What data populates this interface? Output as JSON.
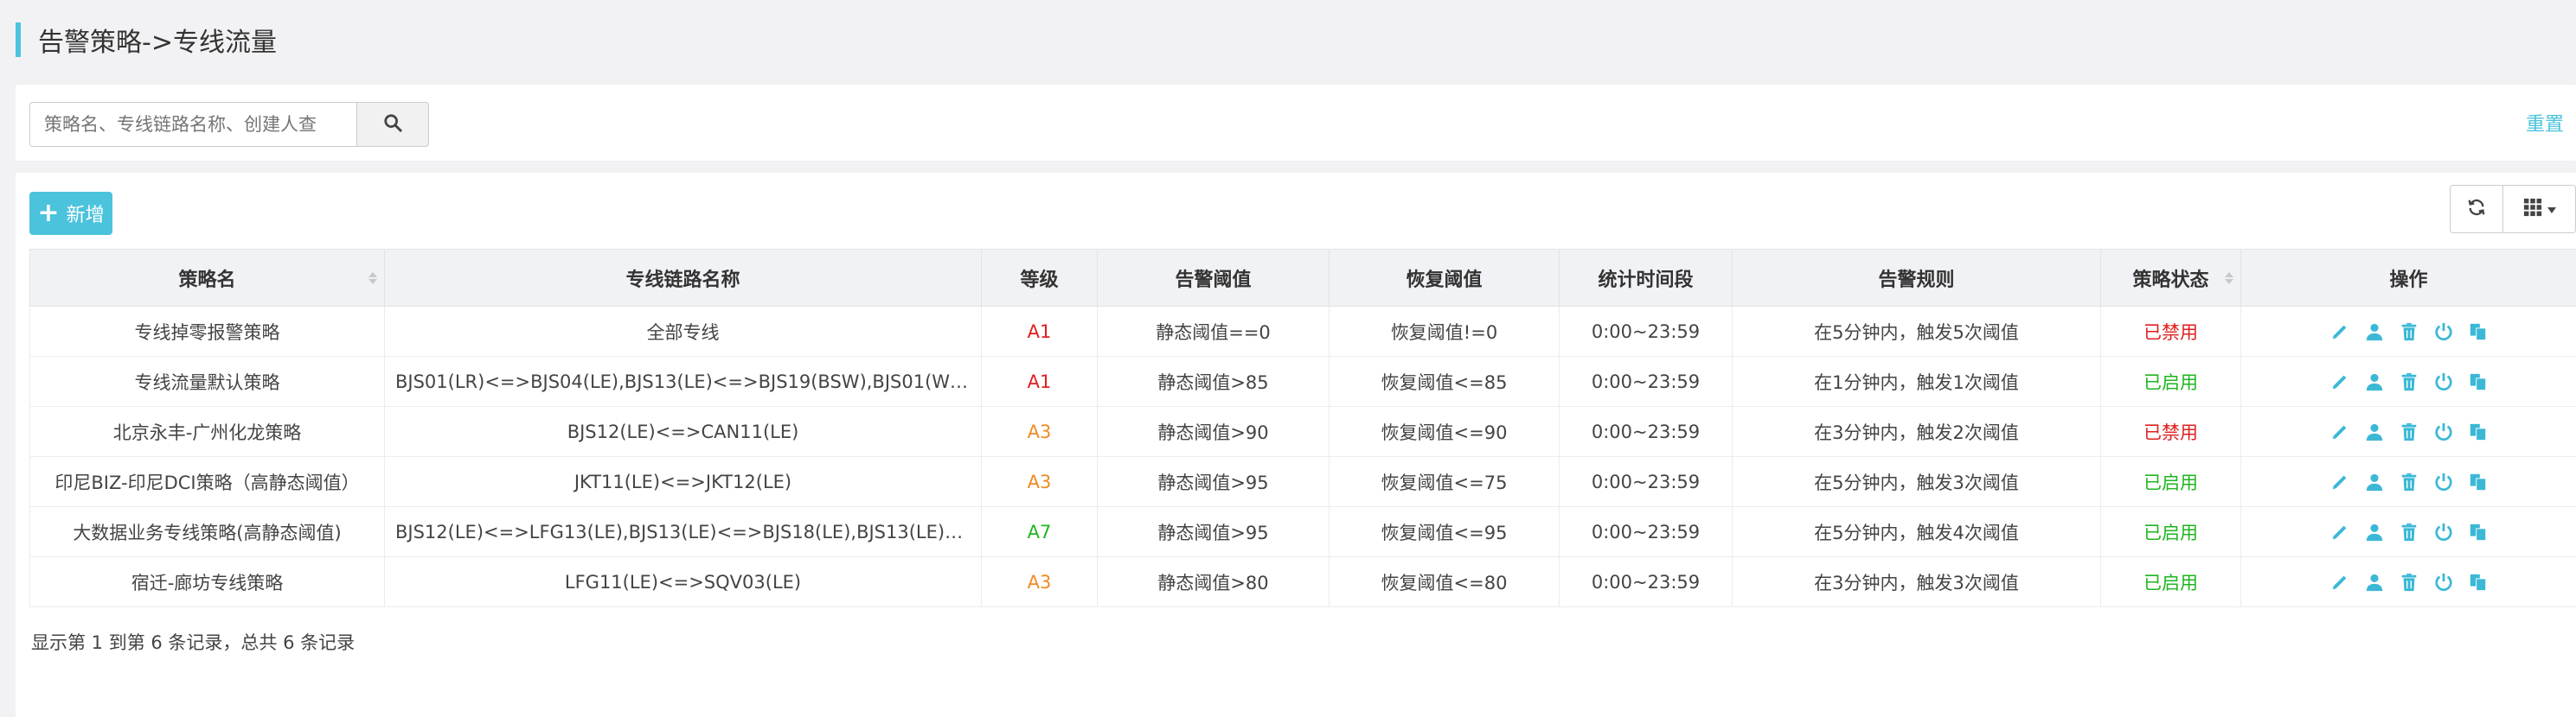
{
  "page": {
    "title": "告警策略->专线流量"
  },
  "search": {
    "placeholder": "策略名、专线链路名称、创建人查",
    "reset_label": "重置"
  },
  "toolbar": {
    "add_label": "新增"
  },
  "colors": {
    "accent": "#4cc3dc",
    "disabled": "#e02020",
    "enabled": "#1fb51f",
    "level_a1": "#e02020",
    "level_a3": "#f08a24",
    "level_a7": "#1fb51f"
  },
  "table": {
    "headers": [
      "策略名",
      "专线链路名称",
      "等级",
      "告警阈值",
      "恢复阈值",
      "统计时间段",
      "告警规则",
      "策略状态",
      "操作"
    ],
    "rows": [
      {
        "name": "专线掉零报警策略",
        "link": "全部专线",
        "level": "A1",
        "alarm": "静态阈值==0",
        "recover": "恢复阈值!=0",
        "period": "0:00~23:59",
        "rule": "在5分钟内，触发5次阈值",
        "status": "已禁用"
      },
      {
        "name": "专线流量默认策略",
        "link": "BJS01(LR)<=>BJS04(LE),BJS13(LE)<=>BJS19(BSW),BJS01(WR)...",
        "level": "A1",
        "alarm": "静态阈值>85",
        "recover": "恢复阈值<=85",
        "period": "0:00~23:59",
        "rule": "在1分钟内，触发1次阈值",
        "status": "已启用"
      },
      {
        "name": "北京永丰-广州化龙策略",
        "link": "BJS12(LE)<=>CAN11(LE)",
        "level": "A3",
        "alarm": "静态阈值>90",
        "recover": "恢复阈值<=90",
        "period": "0:00~23:59",
        "rule": "在3分钟内，触发2次阈值",
        "status": "已禁用"
      },
      {
        "name": "印尼BIZ-印尼DCI策略（高静态阈值）",
        "link": "JKT11(LE)<=>JKT12(LE)",
        "level": "A3",
        "alarm": "静态阈值>95",
        "recover": "恢复阈值<=75",
        "period": "0:00~23:59",
        "rule": "在5分钟内，触发3次阈值",
        "status": "已启用"
      },
      {
        "name": "大数据业务专线策略(高静态阈值)",
        "link": "BJS12(LE)<=>LFG13(LE),BJS13(LE)<=>BJS18(LE),BJS13(LE)<=...",
        "level": "A7",
        "alarm": "静态阈值>95",
        "recover": "恢复阈值<=95",
        "period": "0:00~23:59",
        "rule": "在5分钟内，触发4次阈值",
        "status": "已启用"
      },
      {
        "name": "宿迁-廊坊专线策略",
        "link": "LFG11(LE)<=>SQV03(LE)",
        "level": "A3",
        "alarm": "静态阈值>80",
        "recover": "恢复阈值<=80",
        "period": "0:00~23:59",
        "rule": "在3分钟内，触发3次阈值",
        "status": "已启用"
      }
    ]
  },
  "pagination": {
    "summary": "显示第 1 到第 6 条记录，总共 6 条记录"
  }
}
